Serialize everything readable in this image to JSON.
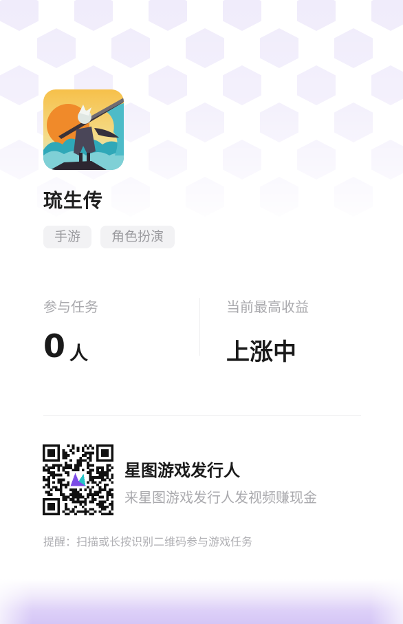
{
  "colors": {
    "pattern": "#f0ecfb",
    "tag_bg": "#f2f2f4",
    "tag_text": "#9a9a9e",
    "label": "#a9a9ad",
    "value": "#1a1a1a",
    "bottom_band": "#d5c6f6",
    "qr_logo": "#7b4be6"
  },
  "app": {
    "icon": "game-icon",
    "title": "琉生传",
    "tags": [
      "手游",
      "角色扮演"
    ]
  },
  "stats": {
    "participants_label": "参与任务",
    "participants_value": "0",
    "participants_unit": "人",
    "max_income_label": "当前最高收益",
    "max_income_value": "上涨中"
  },
  "qr": {
    "icon": "qr-code-icon",
    "title": "星图游戏发行人",
    "subtitle": "来星图游戏发行人发视频赚现金"
  },
  "tip": "提醒：扫描或长按识别二维码参与游戏任务"
}
